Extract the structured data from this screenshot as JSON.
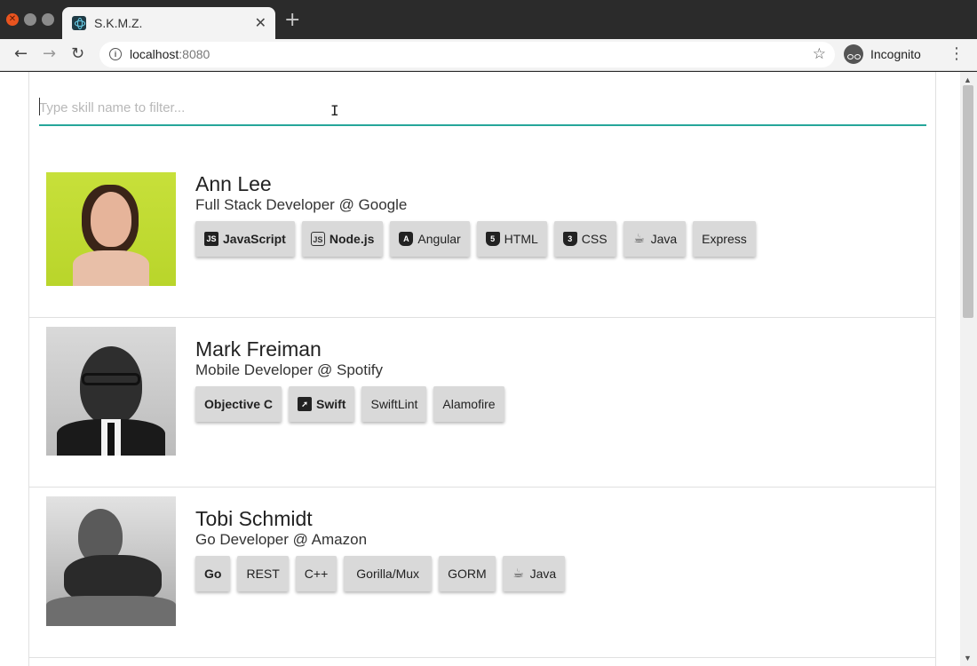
{
  "browser": {
    "tab_title": "S.K.M.Z.",
    "tab_close": "✕",
    "new_tab": "+",
    "url_host": "localhost",
    "url_port": ":8080",
    "incognito_label": "Incognito"
  },
  "filter": {
    "placeholder": "Type skill name to filter..."
  },
  "people": [
    {
      "name": "Ann Lee",
      "role": "Full Stack Developer @ Google",
      "skills": [
        {
          "label": "JavaScript",
          "icon": "javascript-icon",
          "bold": true
        },
        {
          "label": "Node.js",
          "icon": "nodejs-icon",
          "bold": true
        },
        {
          "label": "Angular",
          "icon": "angular-icon",
          "bold": false
        },
        {
          "label": "HTML",
          "icon": "html5-icon",
          "bold": false
        },
        {
          "label": "CSS",
          "icon": "css3-icon",
          "bold": false
        },
        {
          "label": "Java",
          "icon": "java-icon",
          "bold": false
        },
        {
          "label": "Express",
          "icon": null,
          "bold": false
        }
      ]
    },
    {
      "name": "Mark Freiman",
      "role": "Mobile Developer @ Spotify",
      "skills": [
        {
          "label": "Objective C",
          "icon": null,
          "bold": true
        },
        {
          "label": "Swift",
          "icon": "swift-icon",
          "bold": true
        },
        {
          "label": "SwiftLint",
          "icon": null,
          "bold": false
        },
        {
          "label": "Alamofire",
          "icon": null,
          "bold": false
        }
      ]
    },
    {
      "name": "Tobi Schmidt",
      "role": "Go Developer @ Amazon",
      "skills": [
        {
          "label": "Go",
          "icon": null,
          "bold": true
        },
        {
          "label": "REST",
          "icon": null,
          "bold": false
        },
        {
          "label": "C++",
          "icon": null,
          "bold": false
        },
        {
          "label": "Gorilla/Mux",
          "icon": null,
          "bold": false
        },
        {
          "label": "GORM",
          "icon": null,
          "bold": false
        },
        {
          "label": "Java",
          "icon": "java-icon",
          "bold": false
        }
      ]
    }
  ],
  "colors": {
    "accent": "#26a69a",
    "chip_bg": "#d9d9d9"
  }
}
